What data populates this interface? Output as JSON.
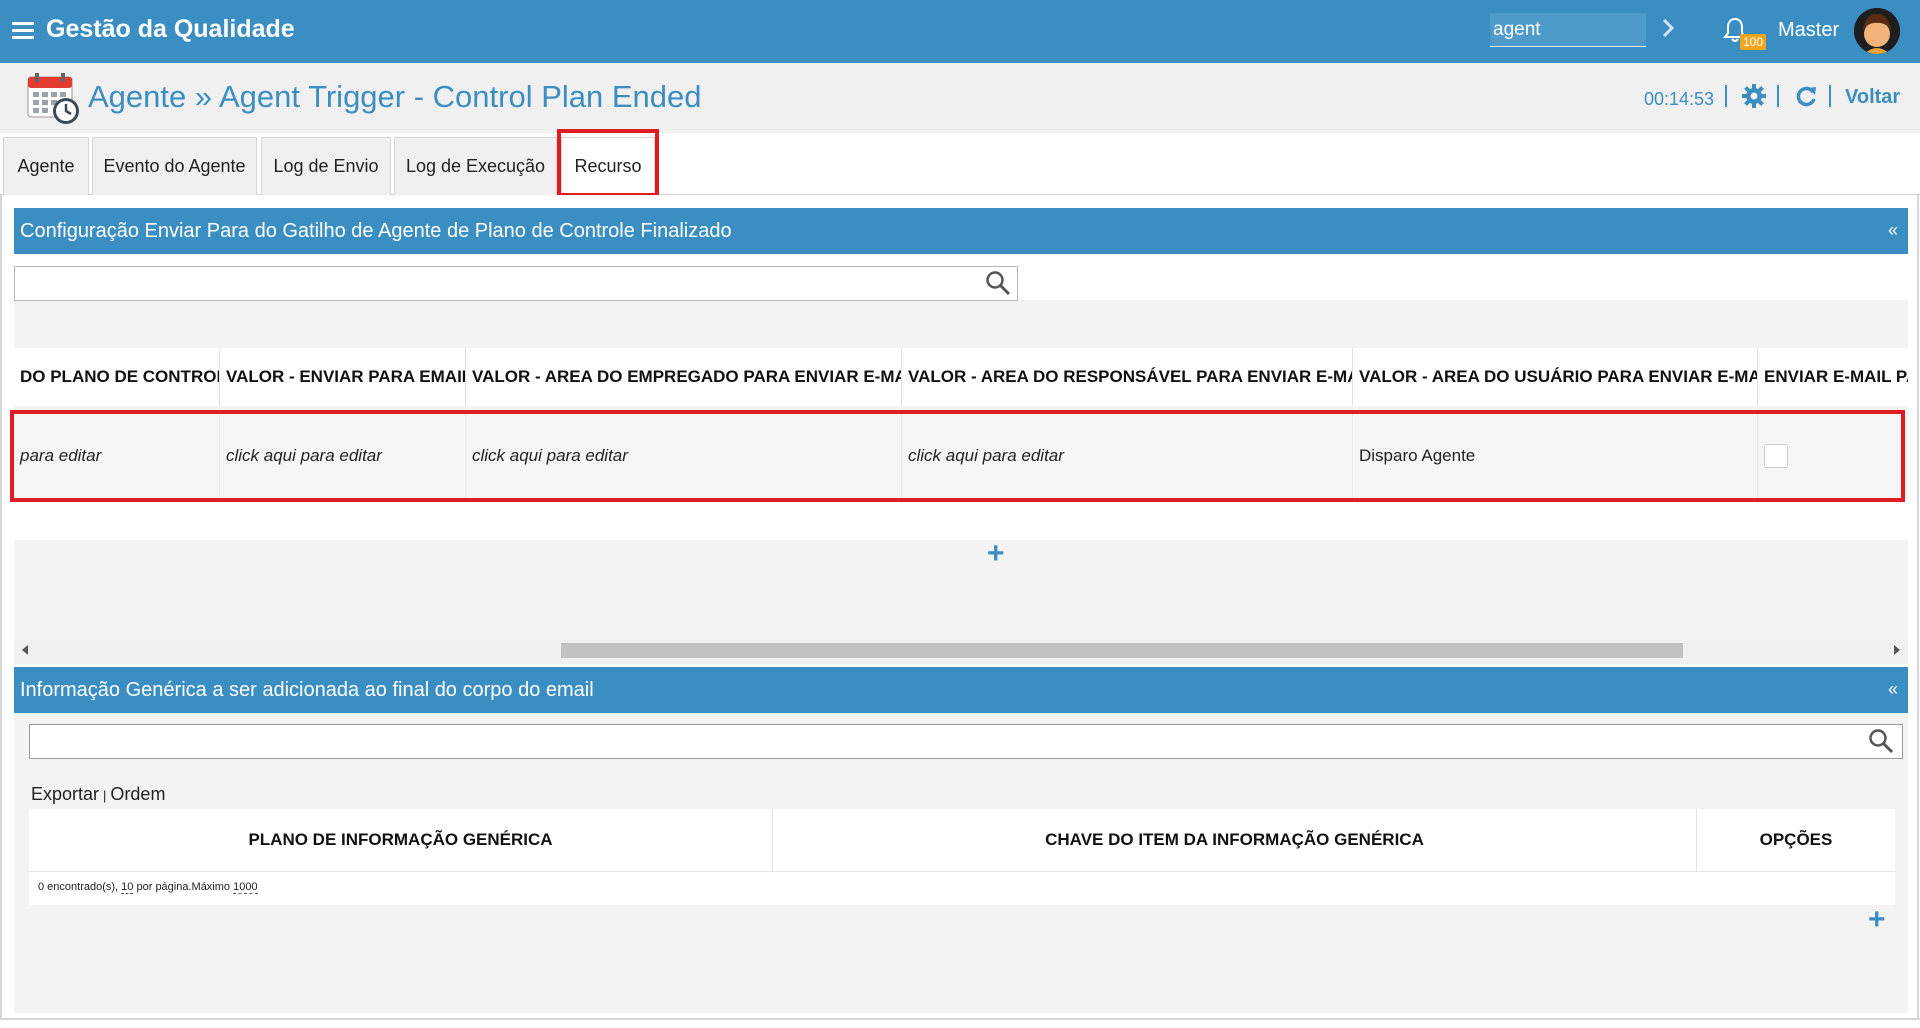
{
  "app": {
    "title": "Gestão da Qualidade",
    "search_value": "agent",
    "notification_count": "100",
    "user_name": "Master"
  },
  "header": {
    "title": "Agente » Agent Trigger - Control Plan Ended",
    "timer": "00:14:53",
    "back_label": "Voltar"
  },
  "tabs": [
    {
      "label": "Agente"
    },
    {
      "label": "Evento do Agente"
    },
    {
      "label": "Log de Envio"
    },
    {
      "label": "Log de Execução"
    },
    {
      "label": "Recurso",
      "active": true
    }
  ],
  "panel1": {
    "title": "Configuração Enviar Para do Gatilho de Agente de Plano de Controle Finalizado",
    "collapse_label": "«",
    "columns": [
      "DO PLANO DE CONTROLE",
      "VALOR - ENVIAR PARA EMAIL",
      "VALOR - AREA DO EMPREGADO PARA ENVIAR E-MAIL",
      "VALOR - AREA DO RESPONSÁVEL PARA ENVIAR E-MAIL",
      "VALOR - AREA DO USUÁRIO PARA ENVIAR E-MAIL",
      "ENVIAR E-MAIL PA"
    ],
    "row": [
      "para editar",
      "click aqui para editar",
      "click aqui para editar",
      "click aqui para editar",
      "Disparo Agente",
      ""
    ],
    "add_label": "+"
  },
  "panel2": {
    "title": "Informação Genérica a ser adicionada ao final do corpo do email",
    "collapse_label": "«",
    "export_label": "Exportar",
    "separator": "|",
    "order_label": "Ordem",
    "columns": [
      "PLANO DE INFORMAÇÃO GENÉRICA",
      "CHAVE DO ITEM DA INFORMAÇÃO GENÉRICA",
      "OPÇÕES"
    ],
    "footer": {
      "found_text": "0 encontrado(s),",
      "page_size": "10",
      "per_page_text": "por página.Máximo",
      "max": "1000"
    },
    "add_label": "+"
  },
  "colors": {
    "brand_blue": "#3b8ec2",
    "highlight_red": "#e01b24",
    "badge_orange": "#f2a51f"
  },
  "icons": [
    "menu-icon",
    "chevron-right-icon",
    "bell-icon",
    "calendar-clock-icon",
    "gear-icon",
    "refresh-icon",
    "search-icon",
    "plus-icon"
  ]
}
